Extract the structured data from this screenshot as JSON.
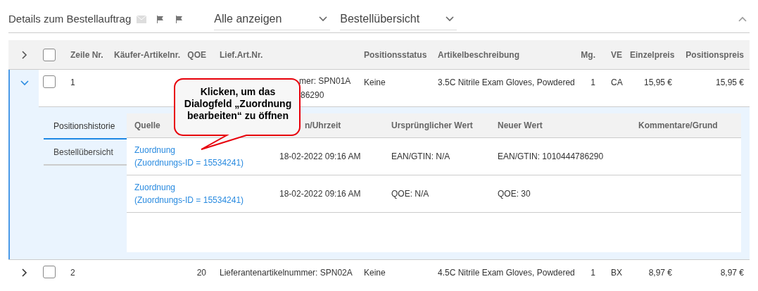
{
  "header": {
    "title": "Details zum Bestellauftrag",
    "filters": [
      {
        "value": "Alle anzeigen"
      },
      {
        "value": "Bestellübersicht"
      }
    ]
  },
  "table": {
    "all_checked": false,
    "columns": [
      "Zeile Nr.",
      "Käufer-Artikelnr.",
      "QOE",
      "Lief.Art.Nr.",
      "Positionsstatus",
      "Artikelbeschreibung",
      "Mg.",
      "VE",
      "Einzelpreis",
      "Positionspreis"
    ],
    "rows": [
      {
        "expanded": true,
        "checked": false,
        "cells": [
          "1",
          "",
          "",
          [
            "mer: SPN01A",
            "86290"
          ],
          "Keine",
          "3.5C Nitrile Exam Gloves, Powdered",
          "1",
          "CA",
          "15,95 €",
          "15,95 €"
        ]
      },
      {
        "expanded": false,
        "checked": false,
        "cells": [
          "2",
          "",
          "20",
          "Lieferantenartikelnummer: SPN02A",
          "Keine",
          "4.5C Nitrile Exam Gloves, Powdered",
          "1",
          "BX",
          "8,97 €",
          "8,97 €"
        ]
      }
    ]
  },
  "history": {
    "tabs": [
      {
        "label": "Positionshistorie",
        "selected": true
      },
      {
        "label": "Bestellübersicht",
        "selected": false
      }
    ],
    "columns": [
      "Quelle",
      "n/Uhrzeit",
      "Ursprünglicher Wert",
      "Neuer Wert",
      "Kommentare/Grund"
    ],
    "rows": [
      {
        "source": [
          "Zuordnung",
          "(Zuordnungs-ID = 15534241)"
        ],
        "date": "18-02-2022 09:16 AM",
        "old": "EAN/GTIN: N/A",
        "new": "EAN/GTIN: 1010444786290"
      },
      {
        "source": [
          "Zuordnung",
          "(Zuordnungs-ID = 15534241)"
        ],
        "date": "18-02-2022 09:16 AM",
        "old": "QOE: N/A",
        "new": "QOE: 30"
      }
    ]
  },
  "callout": {
    "text": "Klicken, um das Dialogfeld „Zuordnung bearbeiten“ zu öffnen"
  }
}
